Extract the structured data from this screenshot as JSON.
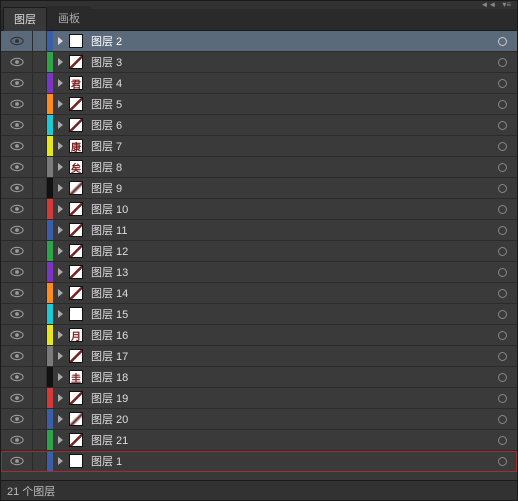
{
  "topbar": {
    "collapse": "◄◄",
    "menu": "▾≡"
  },
  "tabs": {
    "layers": "图层",
    "artboards": "画板"
  },
  "status": "21 个图层",
  "layers": [
    {
      "name": "图层 2",
      "color": "#3a5fa8",
      "thumb": "blank",
      "selected": true
    },
    {
      "name": "图层 3",
      "color": "#2fa34a",
      "thumb": "stroke"
    },
    {
      "name": "图层 4",
      "color": "#7a35c2",
      "thumb": "char",
      "char": "君"
    },
    {
      "name": "图层 5",
      "color": "#ff8a1f",
      "thumb": "stroke"
    },
    {
      "name": "图层 6",
      "color": "#1fc9d4",
      "thumb": "stroke"
    },
    {
      "name": "图层 7",
      "color": "#e6e61f",
      "thumb": "char",
      "char": "康"
    },
    {
      "name": "图层 8",
      "color": "#7a7a7a",
      "thumb": "char",
      "char": "矣"
    },
    {
      "name": "图层 9",
      "color": "#111111",
      "thumb": "stroke2"
    },
    {
      "name": "图层 10",
      "color": "#d43a3a",
      "thumb": "stroke"
    },
    {
      "name": "图层 11",
      "color": "#3a5fa8",
      "thumb": "stroke"
    },
    {
      "name": "图层 12",
      "color": "#2fa34a",
      "thumb": "stroke"
    },
    {
      "name": "图层 13",
      "color": "#7a35c2",
      "thumb": "stroke"
    },
    {
      "name": "图层 14",
      "color": "#ff8a1f",
      "thumb": "stroke"
    },
    {
      "name": "图层 15",
      "color": "#1fc9d4",
      "thumb": "blank"
    },
    {
      "name": "图层 16",
      "color": "#e6e61f",
      "thumb": "char",
      "char": "月"
    },
    {
      "name": "图层 17",
      "color": "#7a7a7a",
      "thumb": "stroke"
    },
    {
      "name": "图层 18",
      "color": "#111111",
      "thumb": "char",
      "char": "圭"
    },
    {
      "name": "图层 19",
      "color": "#d43a3a",
      "thumb": "stroke"
    },
    {
      "name": "图层 20",
      "color": "#3a5fa8",
      "thumb": "stroke2"
    },
    {
      "name": "图层 21",
      "color": "#2fa34a",
      "thumb": "stroke"
    },
    {
      "name": "图层 1",
      "color": "#3a5fa8",
      "thumb": "blank",
      "redbox": true
    }
  ]
}
